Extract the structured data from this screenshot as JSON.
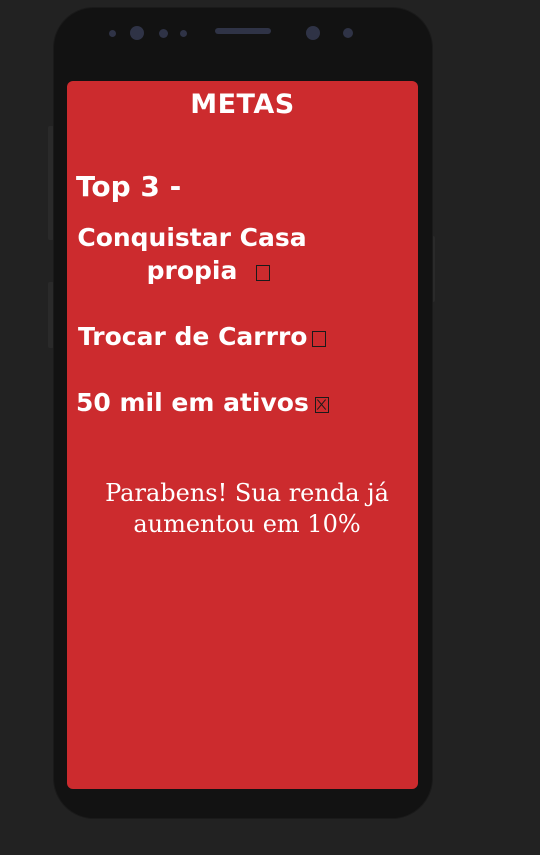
{
  "screen": {
    "title": "METAS",
    "top_heading": "Top 3 -",
    "goals": [
      {
        "line1": "Conquistar Casa",
        "line2": "propia",
        "checked": false
      },
      {
        "label": "Trocar de Carrro",
        "checked": false
      },
      {
        "label": "50 mil em ativos",
        "checked": true
      }
    ],
    "message_line1": "Parabens! Sua renda já",
    "message_line2": "aumentou em 10%"
  },
  "colors": {
    "background": "#222222",
    "phone_frame": "#121212",
    "screen": "#cc2b2e",
    "text": "#ffffff"
  }
}
